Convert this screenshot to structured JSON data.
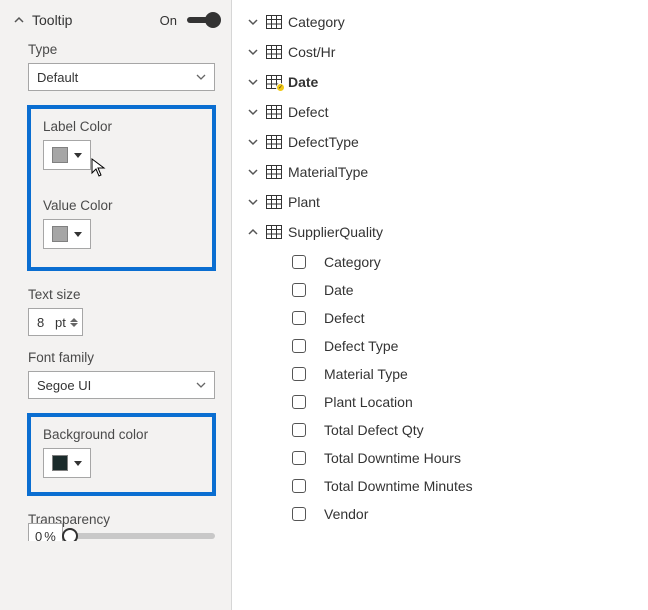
{
  "section": {
    "title": "Tooltip",
    "state": "On"
  },
  "type": {
    "label": "Type",
    "value": "Default"
  },
  "label_color": {
    "label": "Label Color",
    "swatch": "#a6a6a6"
  },
  "value_color": {
    "label": "Value Color",
    "swatch": "#a6a6a6"
  },
  "text_size": {
    "label": "Text size",
    "value": "8",
    "unit": "pt"
  },
  "font_family": {
    "label": "Font family",
    "value": "Segoe UI"
  },
  "background_color": {
    "label": "Background color",
    "swatch": "#1b2b2b"
  },
  "transparency": {
    "label": "Transparency",
    "value": "0",
    "unit": "%"
  },
  "fields": {
    "top_tables": [
      {
        "name": "Category",
        "expanded": false,
        "date": false
      },
      {
        "name": "Cost/Hr",
        "expanded": false,
        "date": false
      },
      {
        "name": "Date",
        "expanded": false,
        "date": true,
        "bold": true
      },
      {
        "name": "Defect",
        "expanded": false,
        "date": false
      },
      {
        "name": "DefectType",
        "expanded": false,
        "date": false
      },
      {
        "name": "MaterialType",
        "expanded": false,
        "date": false
      },
      {
        "name": "Plant",
        "expanded": false,
        "date": false
      }
    ],
    "supplier_quality": {
      "name": "SupplierQuality",
      "expanded": true,
      "columns": [
        "Category",
        "Date",
        "Defect",
        "Defect Type",
        "Material Type",
        "Plant Location",
        "Total Defect Qty",
        "Total Downtime Hours",
        "Total Downtime Minutes",
        "Vendor"
      ]
    }
  }
}
